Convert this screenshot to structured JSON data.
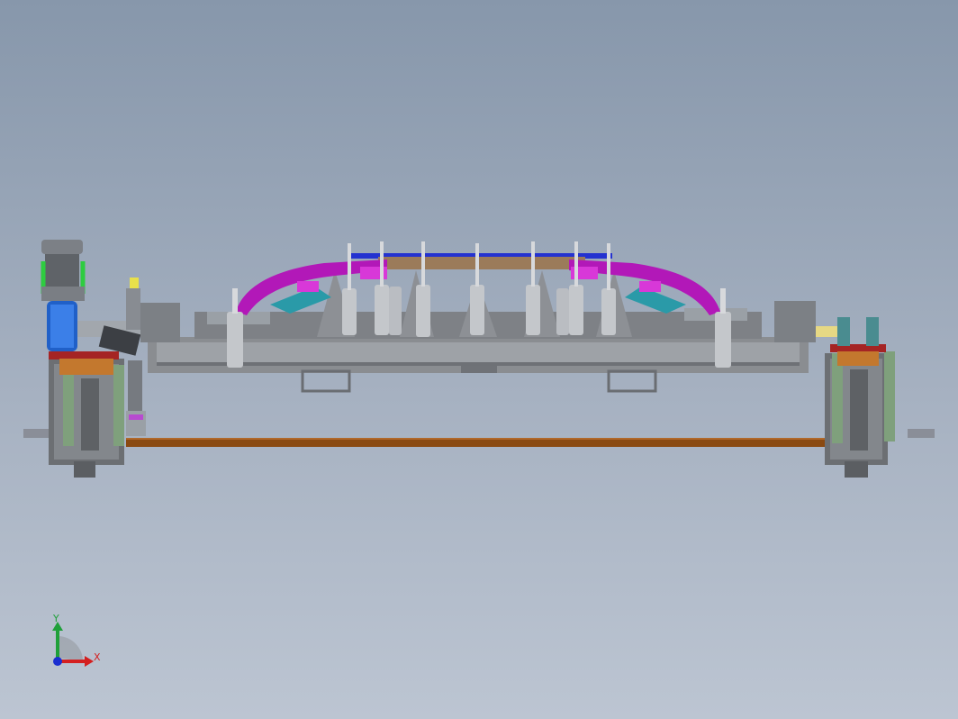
{
  "view": {
    "background_top": "#8797ab",
    "background_bottom": "#bcc5d2"
  },
  "triad": {
    "x_label": "X",
    "y_label": "Y",
    "x_color": "#d42020",
    "y_color": "#1fa03a",
    "z_color": "#1a2fd0"
  },
  "assembly": {
    "frame_color": "#8a8d91",
    "fixture_color": "#b218b8",
    "shaft_color": "#8a4a12",
    "motor_color": "#2060c8",
    "guard_color": "#7fa07c",
    "plate_color": "#a52424"
  }
}
